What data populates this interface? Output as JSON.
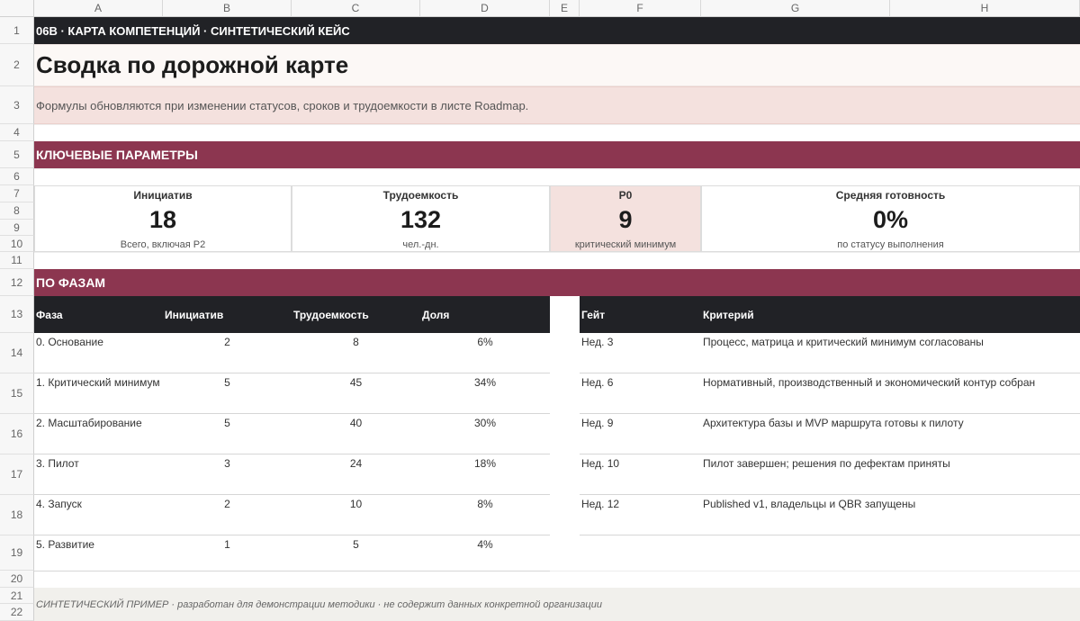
{
  "columns": [
    "A",
    "B",
    "C",
    "D",
    "E",
    "F",
    "G",
    "H"
  ],
  "rows": [
    "1",
    "2",
    "3",
    "4",
    "5",
    "6",
    "7",
    "8",
    "9",
    "10",
    "11",
    "12",
    "13",
    "14",
    "15",
    "16",
    "17",
    "18",
    "19",
    "20",
    "21",
    "22"
  ],
  "header_bar": "06B · КАРТА КОМПЕТЕНЦИЙ · СИНТЕТИЧЕСКИЙ КЕЙС",
  "title": "Сводка по дорожной карте",
  "subtitle": "Формулы обновляются при изменении статусов, сроков и трудоемкости в листе Roadmap.",
  "section_params": "КЛЮЧЕВЫЕ ПАРАМЕТРЫ",
  "kpis": [
    {
      "label": "Инициатив",
      "value": "18",
      "note": "Всего, включая P2"
    },
    {
      "label": "Трудоемкость",
      "value": "132",
      "note": "чел.-дн."
    },
    {
      "label": "P0",
      "value": "9",
      "note": "критический минимум"
    },
    {
      "label": "Средняя готовность",
      "value": "0%",
      "note": "по статусу выполнения"
    }
  ],
  "section_phases": "ПО ФАЗАМ",
  "phase_headers": [
    "Фаза",
    "Инициатив",
    "Трудоемкость",
    "Доля"
  ],
  "phases": [
    {
      "name": "0. Основание",
      "initiatives": "2",
      "effort": "8",
      "share": "6%"
    },
    {
      "name": "1. Критический минимум",
      "initiatives": "5",
      "effort": "45",
      "share": "34%"
    },
    {
      "name": "2. Масштабирование",
      "initiatives": "5",
      "effort": "40",
      "share": "30%"
    },
    {
      "name": "3. Пилот",
      "initiatives": "3",
      "effort": "24",
      "share": "18%"
    },
    {
      "name": "4. Запуск",
      "initiatives": "2",
      "effort": "10",
      "share": "8%"
    },
    {
      "name": "5. Развитие",
      "initiatives": "1",
      "effort": "5",
      "share": "4%"
    }
  ],
  "gate_headers": [
    "Гейт",
    "Критерий"
  ],
  "gates": [
    {
      "gate": "Нед. 3",
      "criterion": "Процесс, матрица и критический минимум согласованы"
    },
    {
      "gate": "Нед. 6",
      "criterion": "Нормативный, производственный и экономический контур собран"
    },
    {
      "gate": "Нед. 9",
      "criterion": "Архитектура базы и MVP маршрута готовы к пилоту"
    },
    {
      "gate": "Нед. 10",
      "criterion": "Пилот завершен; решения по дефектам приняты"
    },
    {
      "gate": "Нед. 12",
      "criterion": "Published v1, владельцы и QBR запущены"
    }
  ],
  "footer": "СИНТЕТИЧЕСКИЙ ПРИМЕР · разработан для демонстрации методики · не содержит данных конкретной организации"
}
